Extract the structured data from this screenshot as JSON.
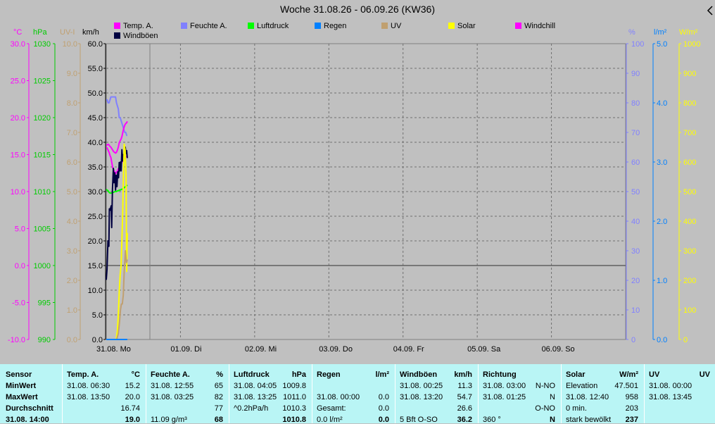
{
  "title": "Woche 31.08.26 - 06.09.26 (KW36)",
  "legend": [
    {
      "label": "Temp. A.",
      "color": "#ff00ff",
      "row": 0,
      "col": 0
    },
    {
      "label": "Feuchte A.",
      "color": "#8080ff",
      "row": 0,
      "col": 1
    },
    {
      "label": "Luftdruck",
      "color": "#00ff00",
      "row": 0,
      "col": 2
    },
    {
      "label": "Regen",
      "color": "#0080ff",
      "row": 0,
      "col": 3
    },
    {
      "label": "UV",
      "color": "#c0a070",
      "row": 0,
      "col": 4
    },
    {
      "label": "Solar",
      "color": "#ffff00",
      "row": 0,
      "col": 5
    },
    {
      "label": "Windchill",
      "color": "#ff00ff",
      "row": 0,
      "col": 6
    },
    {
      "label": "Windböen",
      "color": "#000040",
      "row": 1,
      "col": 0
    }
  ],
  "units": {
    "temp": "°C",
    "press": "hPa",
    "uv": "UV-I",
    "wind": "km/h",
    "hum": "%",
    "rain": "l/m²",
    "solar": "W/m²"
  },
  "chart_data": {
    "type": "line",
    "title": "Woche 31.08.26 - 06.09.26 (KW36)",
    "x_days": [
      "31.08. Mo",
      "01.09. Di",
      "02.09. Mi",
      "03.09. Do",
      "04.09. Fr",
      "05.09. Sa",
      "06.09. So"
    ],
    "axes": {
      "temp": {
        "unit": "°C",
        "range": [
          -10,
          30
        ],
        "ticks": [
          "30.0",
          "25.0",
          "20.0",
          "15.0",
          "10.0",
          "5.0",
          "0.0",
          "-5.0",
          "-10.0"
        ],
        "color": "#ff00ff"
      },
      "press": {
        "unit": "hPa",
        "range": [
          990,
          1030
        ],
        "ticks": [
          "1030",
          "1025",
          "1020",
          "1015",
          "1010",
          "1005",
          "1000",
          "995",
          "990"
        ],
        "color": "#00ff00"
      },
      "uv": {
        "unit": "UV-I",
        "range": [
          0,
          10
        ],
        "ticks": [
          "10.0",
          "9.0",
          "8.0",
          "7.0",
          "6.0",
          "5.0",
          "4.0",
          "3.0",
          "2.0",
          "1.0",
          "0.0"
        ],
        "color": "#c0a070"
      },
      "wind": {
        "unit": "km/h",
        "range": [
          0,
          60
        ],
        "ticks": [
          "60.0",
          "55.0",
          "50.0",
          "45.0",
          "40.0",
          "35.0",
          "30.0",
          "25.0",
          "20.0",
          "15.0",
          "10.0",
          "5.0",
          "0.0"
        ],
        "color": "#000000"
      },
      "hum": {
        "unit": "%",
        "range": [
          0,
          100
        ],
        "ticks": [
          "100",
          "90",
          "80",
          "70",
          "60",
          "50",
          "40",
          "30",
          "20",
          "10",
          "0"
        ],
        "color": "#8080ff"
      },
      "rain": {
        "unit": "l/m²",
        "range": [
          0,
          5
        ],
        "ticks": [
          "5.0",
          "4.0",
          "3.0",
          "2.0",
          "1.0",
          "0.0"
        ],
        "color": "#0080ff"
      },
      "solar": {
        "unit": "W/m²",
        "range": [
          0,
          1000
        ],
        "ticks": [
          "1000",
          "900",
          "800",
          "700",
          "600",
          "500",
          "400",
          "300",
          "200",
          "100",
          "0"
        ],
        "color": "#ffff00"
      }
    },
    "series": [
      {
        "name": "Feuchte A.",
        "axis": "hum",
        "color": "#8080ff",
        "x": [
          0,
          0.3,
          0.6,
          0.9,
          1.2,
          1.5,
          1.8,
          2.1,
          2.4,
          2.7,
          3.0,
          3.3,
          3.6,
          3.9,
          4.2,
          4.5,
          4.8,
          5.1,
          5.4,
          5.7,
          6.0,
          6.3,
          6.6,
          6.8
        ],
        "y": [
          81,
          81,
          80,
          80,
          81,
          82,
          82,
          82,
          82,
          82,
          82,
          80,
          79,
          78,
          75,
          75,
          74,
          73,
          72,
          71,
          70,
          70,
          69,
          69
        ]
      },
      {
        "name": "Temp. A.",
        "axis": "temp",
        "color": "#ff00ff",
        "x": [
          0,
          0.3,
          0.6,
          0.9,
          1.2,
          1.5,
          1.8,
          2.1,
          2.4,
          2.7,
          3.0,
          3.3,
          3.6,
          3.9,
          4.2,
          4.5,
          4.8,
          5.1,
          5.4,
          5.7,
          6.0,
          6.3,
          6.6,
          6.8
        ],
        "y": [
          16.3,
          16.3,
          16.4,
          16.3,
          16.1,
          16.0,
          15.8,
          15.6,
          15.4,
          15.3,
          15.2,
          15.3,
          15.6,
          16.0,
          16.6,
          16.9,
          17.1,
          17.5,
          18.1,
          18.6,
          19.0,
          19.2,
          19.3,
          19.5
        ]
      },
      {
        "name": "Windchill",
        "axis": "temp",
        "color": "#ff00ff",
        "x": [
          0,
          0.3,
          0.6,
          0.9,
          1.2,
          1.5,
          1.8,
          2.1,
          2.4,
          2.7,
          3.0,
          3.3,
          3.6,
          3.9,
          4.2,
          4.5,
          4.8,
          5.1,
          5.4,
          5.7,
          6.0,
          6.3,
          6.6,
          6.8
        ],
        "y": [
          16.0,
          15.9,
          15.6,
          15.3,
          14.9,
          14.6,
          13.9,
          13.2,
          13.0,
          12.7,
          12.4,
          12.6,
          12.8,
          13.1,
          12.9,
          13.3,
          13.8,
          14.0,
          14.2,
          14.3,
          14.5,
          14.7,
          14.8,
          14.8
        ]
      },
      {
        "name": "Luftdruck",
        "axis": "press",
        "color": "#00ff00",
        "x": [
          0,
          0.3,
          0.6,
          0.9,
          1.2,
          1.5,
          1.8,
          2.1,
          2.4,
          2.7,
          3.0,
          3.3,
          3.6,
          3.9,
          4.2,
          4.5,
          4.8,
          5.1,
          5.4,
          5.7,
          6.0,
          6.3,
          6.6,
          6.8
        ],
        "y": [
          1010.3,
          1010.2,
          1010.1,
          1009.9,
          1009.8,
          1009.8,
          1009.8,
          1009.9,
          1009.9,
          1010.0,
          1010.0,
          1010.0,
          1010.1,
          1010.1,
          1010.2,
          1010.2,
          1010.3,
          1010.3,
          1010.4,
          1010.5,
          1010.6,
          1010.7,
          1010.8,
          1010.9
        ]
      },
      {
        "name": "Windböen",
        "axis": "wind",
        "color": "#000040",
        "x": [
          0,
          0.25,
          0.55,
          0.85,
          1.0,
          1.2,
          1.4,
          1.6,
          1.75,
          2.0,
          2.3,
          2.5,
          2.75,
          3.0,
          3.2,
          3.45,
          3.7,
          3.95,
          4.2,
          4.4,
          4.6,
          4.8,
          5.05,
          5.3,
          5.5,
          5.7,
          5.95,
          6.15,
          6.4,
          6.6,
          6.8
        ],
        "y": [
          12.1,
          14.3,
          20.0,
          18.9,
          26.5,
          26.2,
          26.7,
          27.1,
          22.7,
          30.5,
          34.7,
          31.8,
          33.8,
          30.3,
          33.3,
          31.0,
          34.0,
          32.8,
          35.9,
          34.2,
          36.0,
          34.2,
          38.5,
          36.2,
          37.5,
          36.4,
          37.6,
          39.0,
          37.7,
          38.3,
          36.8
        ]
      },
      {
        "name": "Solar",
        "axis": "solar",
        "color": "#ffff00",
        "x": [
          0,
          1.0,
          2.0,
          2.5,
          2.8,
          3.2,
          3.6,
          3.9,
          4.2,
          4.5,
          4.8,
          5.1,
          5.3,
          5.5,
          5.8,
          6.1,
          6.4,
          6.6,
          6.8
        ],
        "y": [
          0,
          0,
          0,
          0,
          0,
          0,
          30,
          80,
          160,
          220,
          250,
          350,
          420,
          530,
          660,
          640,
          550,
          230,
          360
        ]
      },
      {
        "name": "UV",
        "axis": "uv",
        "color": "#c0a070",
        "x": [
          0,
          2.8,
          3.4,
          3.9,
          4.3,
          4.6,
          4.9,
          5.2,
          5.5,
          5.8,
          6.2,
          6.5,
          6.8
        ],
        "y": [
          0,
          0,
          0,
          0.2,
          0.6,
          1.0,
          1.2,
          1.2,
          1.5,
          2.3,
          3.0,
          2.6,
          2.7
        ]
      },
      {
        "name": "Regen",
        "axis": "rain",
        "color": "#0080ff",
        "x": [
          0,
          6.8
        ],
        "y": [
          0,
          0
        ]
      }
    ]
  },
  "stats": {
    "row_labels": [
      "Sensor",
      "MinWert",
      "MaxWert",
      "Durchschnitt",
      "31.08. 14:00"
    ],
    "cols": [
      {
        "name": "Temp. A.",
        "unit": "°C",
        "rows": [
          [
            "31.08. 06:30",
            "15.2"
          ],
          [
            "31.08. 13:50",
            "20.0"
          ],
          [
            "",
            "16.74"
          ],
          [
            "",
            "19.0"
          ]
        ]
      },
      {
        "name": "Feuchte A.",
        "unit": "%",
        "rows": [
          [
            "31.08. 12:55",
            "65"
          ],
          [
            "31.08. 03:25",
            "82"
          ],
          [
            "",
            "77"
          ],
          [
            "11.09 g/m³",
            "68"
          ]
        ]
      },
      {
        "name": "Luftdruck",
        "unit": "hPa",
        "rows": [
          [
            "31.08. 04:05",
            "1009.8"
          ],
          [
            "31.08. 13:25",
            "1011.0"
          ],
          [
            "^0.2hPa/h",
            "1010.3"
          ],
          [
            "",
            "1010.8"
          ]
        ]
      },
      {
        "name": "Regen",
        "unit": "l/m²",
        "rows": [
          [
            "",
            ""
          ],
          [
            "31.08. 00:00",
            "0.0"
          ],
          [
            "Gesamt:",
            "0.0"
          ],
          [
            "0.0 l/m²",
            "0.0"
          ]
        ]
      },
      {
        "name": "Windböen",
        "unit": "km/h",
        "rows": [
          [
            "31.08. 00:25",
            "11.3"
          ],
          [
            "31.08. 13:20",
            "54.7"
          ],
          [
            "",
            "26.6"
          ],
          [
            "5 Bft O-SO",
            "36.2"
          ]
        ]
      },
      {
        "name": "Richtung",
        "unit": "",
        "rows": [
          [
            "31.08. 03:00",
            "N-NO"
          ],
          [
            "31.08. 01:25",
            "N"
          ],
          [
            "",
            "O-NO"
          ],
          [
            "360 °",
            "N"
          ]
        ]
      },
      {
        "name": "Solar",
        "unit": "W/m²",
        "rows": [
          [
            "Elevation",
            "47.501"
          ],
          [
            "31.08. 12:40",
            "958"
          ],
          [
            "0 min.",
            "203"
          ],
          [
            "stark bewölkt",
            "237"
          ]
        ]
      },
      {
        "name": "UV",
        "unit": "UV",
        "rows": [
          [
            "31.08. 00:00",
            ""
          ],
          [
            "31.08. 13:45",
            ""
          ],
          [
            "",
            ""
          ],
          [
            "",
            ""
          ]
        ]
      }
    ]
  }
}
